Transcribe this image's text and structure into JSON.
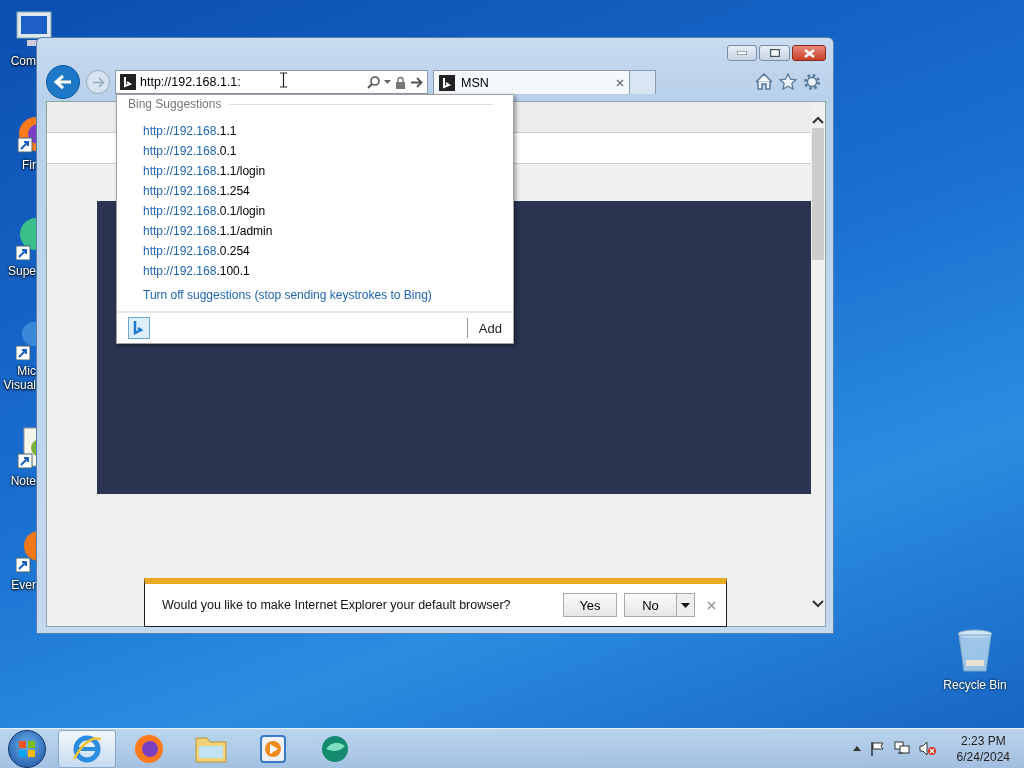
{
  "desktop_icons": [
    {
      "kind": "computer",
      "lines": [
        "Com"
      ]
    },
    {
      "kind": "firefox",
      "lines": [
        "Fir"
      ]
    },
    {
      "kind": "sphere",
      "lines": [
        "Supe"
      ]
    },
    {
      "kind": "ball",
      "lines": [
        "Mic",
        "Visual"
      ]
    },
    {
      "kind": "notepad",
      "lines": [
        "Note"
      ]
    },
    {
      "kind": "blob",
      "lines": [
        "Ever"
      ]
    }
  ],
  "recycle_bin": {
    "label": "Recycle Bin"
  },
  "browser": {
    "address": {
      "value": "http://192.168.1.1:"
    },
    "tab": {
      "title": "MSN"
    },
    "suggestions": {
      "heading": "Bing Suggestions",
      "items": [
        {
          "match": "http://192.168",
          "rest": ".1.1"
        },
        {
          "match": "http://192.168",
          "rest": ".0.1"
        },
        {
          "match": "http://192.168",
          "rest": ".1.1/login"
        },
        {
          "match": "http://192.168",
          "rest": ".1.254"
        },
        {
          "match": "http://192.168",
          "rest": ".0.1/login"
        },
        {
          "match": "http://192.168",
          "rest": ".1.1/admin"
        },
        {
          "match": "http://192.168",
          "rest": ".0.254"
        },
        {
          "match": "http://192.168",
          "rest": ".100.1"
        }
      ],
      "turn_off": "Turn off suggestions (stop sending keystrokes to Bing)",
      "add": "Add"
    },
    "notification": {
      "message": "Would you like to make Internet Explorer your default browser?",
      "yes": "Yes",
      "no": "No"
    }
  },
  "taskbar": {
    "apps": [
      {
        "kind": "ie",
        "selected": true
      },
      {
        "kind": "firefox",
        "selected": false
      },
      {
        "kind": "folder",
        "selected": false
      },
      {
        "kind": "media",
        "selected": false
      },
      {
        "kind": "green",
        "selected": false
      }
    ],
    "clock": {
      "time": "2:23 PM",
      "date": "6/24/2024"
    }
  }
}
